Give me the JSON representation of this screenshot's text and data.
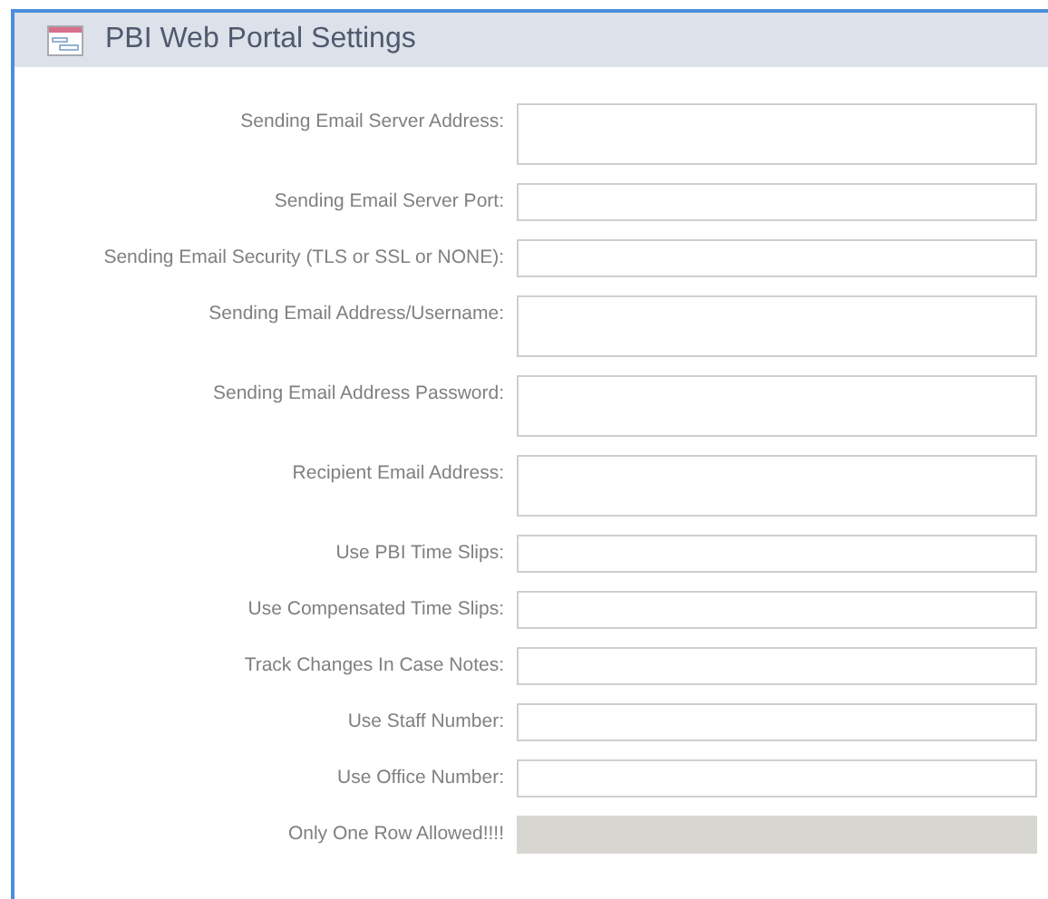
{
  "window": {
    "title": "PBI Web Portal Settings"
  },
  "fields": [
    {
      "label": "Sending Email Server Address:",
      "kind": "tall"
    },
    {
      "label": "Sending Email Server Port:",
      "kind": "short"
    },
    {
      "label": "Sending Email Security (TLS or SSL or NONE):",
      "kind": "short"
    },
    {
      "label": "Sending Email Address/Username:",
      "kind": "tall"
    },
    {
      "label": "Sending Email Address Password:",
      "kind": "tall"
    },
    {
      "label": "Recipient Email Address:",
      "kind": "tall"
    },
    {
      "label": "Use PBI Time Slips:",
      "kind": "short"
    },
    {
      "label": "Use Compensated Time Slips:",
      "kind": "short"
    },
    {
      "label": "Track Changes In Case Notes:",
      "kind": "short"
    },
    {
      "label": "Use Staff Number:",
      "kind": "short"
    },
    {
      "label": "Use Office Number:",
      "kind": "short"
    },
    {
      "label": "Only One Row Allowed!!!!",
      "kind": "locked"
    }
  ]
}
